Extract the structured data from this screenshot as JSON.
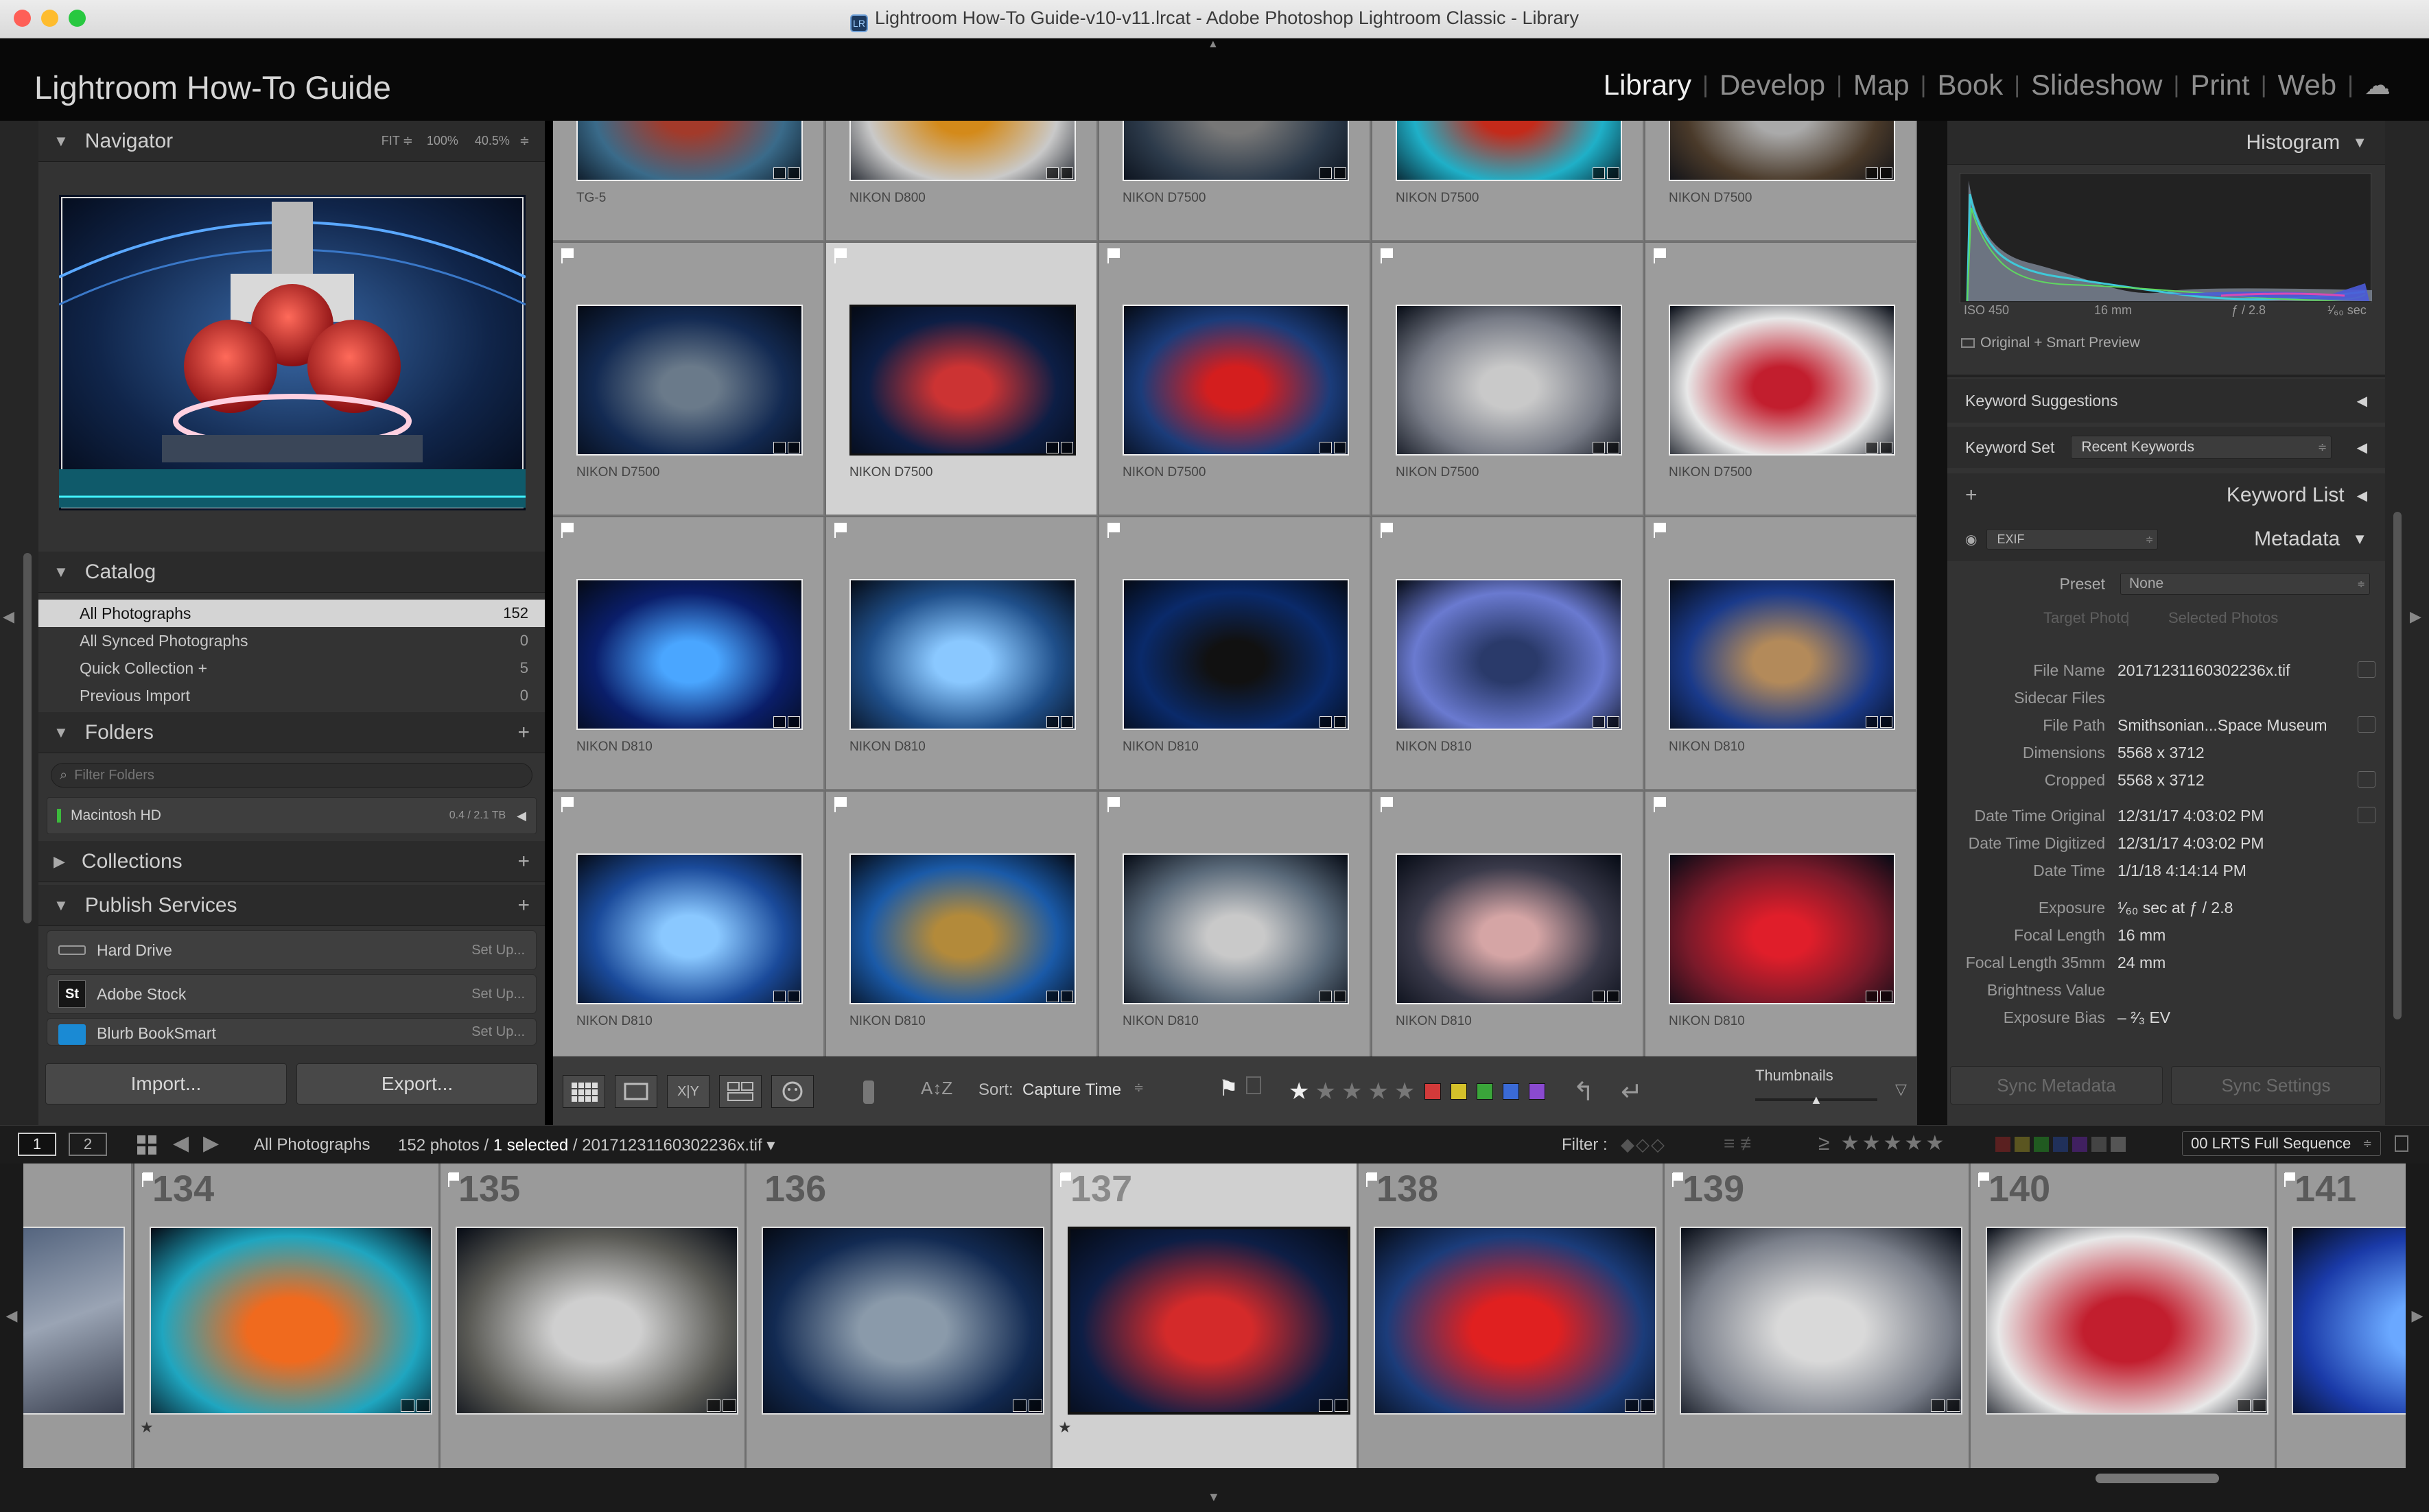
{
  "window": {
    "title": "Lightroom How-To Guide-v10-v11.lrcat - Adobe Photoshop Lightroom Classic - Library"
  },
  "identity_plate": "Lightroom How-To Guide",
  "modules": [
    {
      "label": "Library",
      "active": true
    },
    {
      "label": "Develop",
      "active": false
    },
    {
      "label": "Map",
      "active": false
    },
    {
      "label": "Book",
      "active": false
    },
    {
      "label": "Slideshow",
      "active": false
    },
    {
      "label": "Print",
      "active": false
    },
    {
      "label": "Web",
      "active": false
    }
  ],
  "navigator": {
    "title": "Navigator",
    "zoom_fit": "FIT",
    "zoom_100": "100%",
    "zoom_pct": "40.5%"
  },
  "catalog": {
    "title": "Catalog",
    "items": [
      {
        "label": "All Photographs",
        "count": "152"
      },
      {
        "label": "All Synced Photographs",
        "count": "0"
      },
      {
        "label": "Quick Collection +",
        "count": "5"
      },
      {
        "label": "Previous Import",
        "count": "0"
      }
    ]
  },
  "folders": {
    "title": "Folders",
    "filter_placeholder": "Filter Folders",
    "volume_name": "Macintosh HD",
    "volume_space": "0.4 / 2.1 TB"
  },
  "collections": {
    "title": "Collections"
  },
  "publish": {
    "title": "Publish Services",
    "items": [
      {
        "label": "Hard Drive",
        "action": "Set Up..."
      },
      {
        "label": "Adobe Stock",
        "action": "Set Up..."
      },
      {
        "label": "Blurb BookSmart",
        "action": "Set Up..."
      }
    ]
  },
  "left_buttons": {
    "import": "Import...",
    "export": "Export..."
  },
  "grid": {
    "rows": [
      [
        "TG-5",
        "NIKON D800",
        "NIKON D7500",
        "NIKON D7500",
        "NIKON D7500"
      ],
      [
        "NIKON D7500",
        "NIKON D7500",
        "NIKON D7500",
        "NIKON D7500",
        "NIKON D7500"
      ],
      [
        "NIKON D810",
        "NIKON D810",
        "NIKON D810",
        "NIKON D810",
        "NIKON D810"
      ],
      [
        "NIKON D810",
        "NIKON D810",
        "NIKON D810",
        "NIKON D810",
        "NIKON D810"
      ]
    ]
  },
  "toolbar": {
    "sort_label": "Sort:",
    "sort_value": "Capture Time",
    "thumbnails_label": "Thumbnails",
    "color_labels": [
      "#d23a3a",
      "#d4c12a",
      "#3aa53a",
      "#3a6ad6",
      "#8a4ad0"
    ]
  },
  "histogram": {
    "title": "Histogram",
    "iso": "ISO 450",
    "focal": "16 mm",
    "aperture": "ƒ / 2.8",
    "shutter": "¹⁄₆₀ sec",
    "preview_status": "Original + Smart Preview"
  },
  "keywording": {
    "suggestions_title": "Keyword Suggestions",
    "set_label": "Keyword Set",
    "set_value": "Recent Keywords",
    "list_title": "Keyword List"
  },
  "metadata": {
    "title": "Metadata",
    "view": "EXIF",
    "preset_label": "Preset",
    "preset_value": "None",
    "target_photo": "Target Photo",
    "selected_photos": "Selected Photos",
    "fields": [
      {
        "k": "File Name",
        "v": "20171231160302236x.tif"
      },
      {
        "k": "Sidecar Files",
        "v": ""
      },
      {
        "k": "File Path",
        "v": "Smithsonian...Space Museum"
      },
      {
        "k": "Dimensions",
        "v": "5568 x 3712"
      },
      {
        "k": "Cropped",
        "v": "5568 x 3712"
      },
      {
        "k": "Date Time Original",
        "v": "12/31/17 4:03:02 PM"
      },
      {
        "k": "Date Time Digitized",
        "v": "12/31/17 4:03:02 PM"
      },
      {
        "k": "Date Time",
        "v": "1/1/18 4:14:14 PM"
      },
      {
        "k": "Exposure",
        "v": "¹⁄₆₀ sec at ƒ / 2.8"
      },
      {
        "k": "Focal Length",
        "v": "16 mm"
      },
      {
        "k": "Focal Length 35mm",
        "v": "24 mm"
      },
      {
        "k": "Brightness Value",
        "v": ""
      },
      {
        "k": "Exposure Bias",
        "v": "– ²⁄₃ EV"
      }
    ]
  },
  "right_buttons": {
    "sync_metadata": "Sync Metadata",
    "sync_settings": "Sync Settings"
  },
  "statusbar": {
    "screen1": "1",
    "screen2": "2",
    "source": "All Photographs",
    "count": "152 photos / ",
    "selected": "1 selected",
    "file": "/ 20171231160302236x.tif",
    "filter_label": "Filter :",
    "preset": "00 LRTS Full Sequence"
  },
  "filmstrip": {
    "numbers": [
      "134",
      "135",
      "136",
      "137",
      "138",
      "139",
      "140",
      "141"
    ]
  }
}
